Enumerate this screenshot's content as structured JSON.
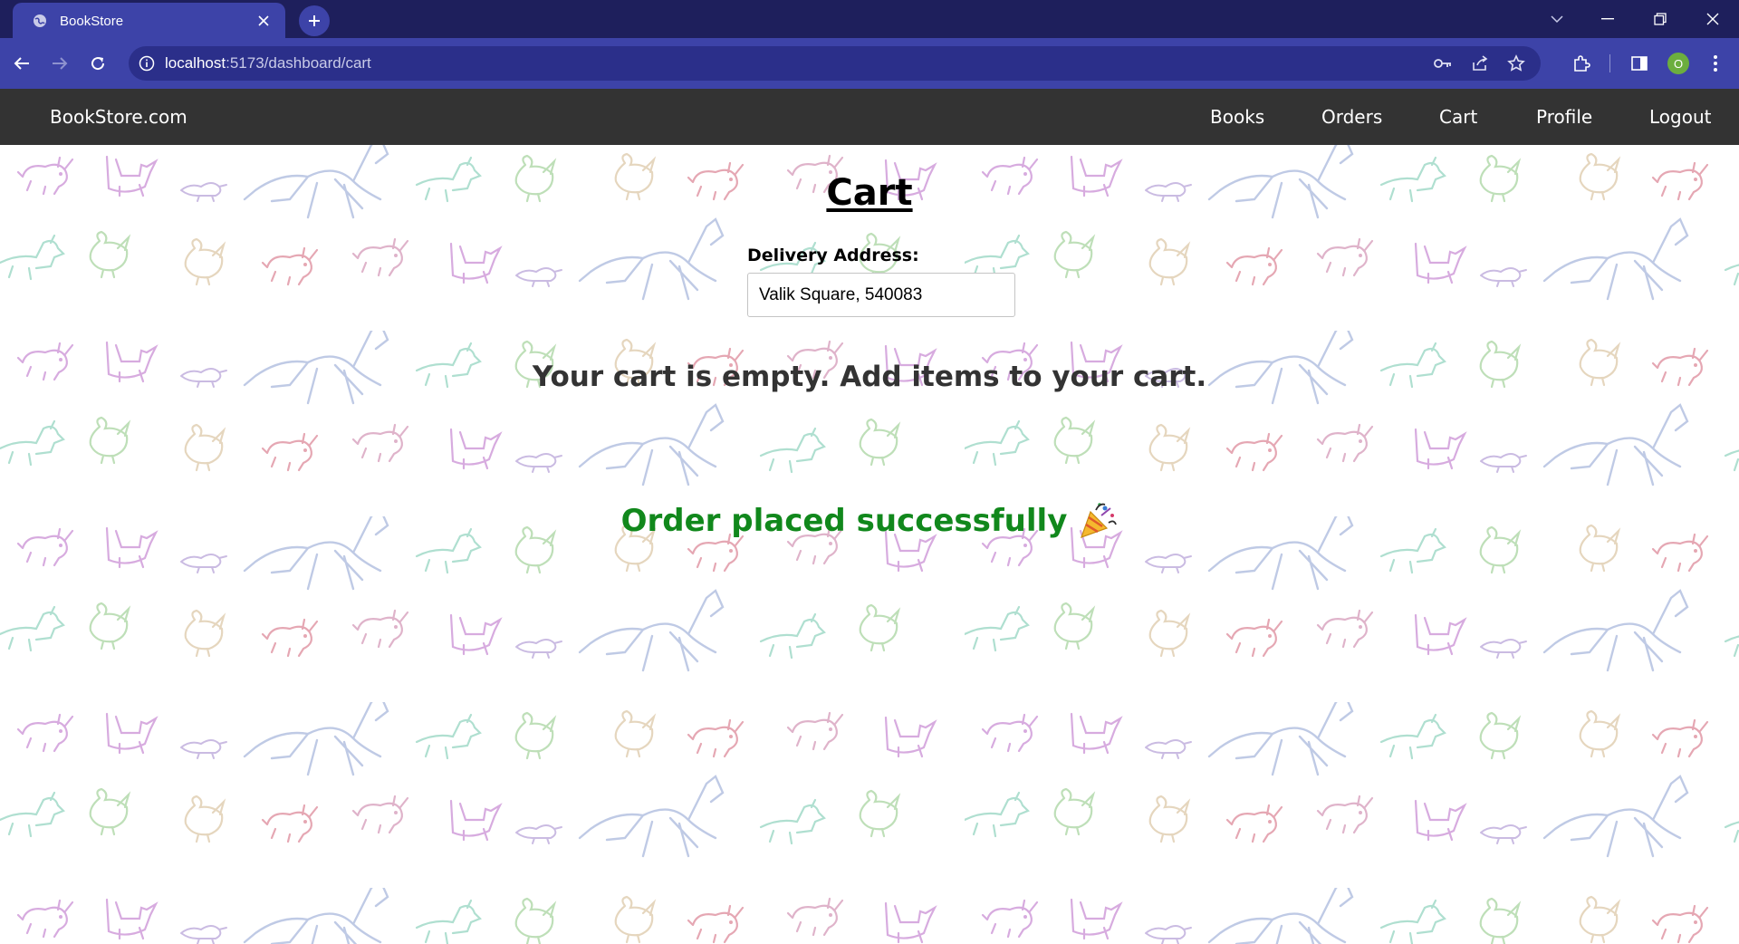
{
  "browser": {
    "tab": {
      "title": "BookStore",
      "favicon": "globe-icon"
    },
    "address_bar": {
      "host": "localhost",
      "rest": ":5173/dashboard/cart"
    },
    "profile_initial": "O",
    "colors": {
      "frame": "#1e1f5c",
      "toolbar": "#3d43a8",
      "omnibox": "#2b2f8a"
    }
  },
  "navbar": {
    "brand": "BookStore.com",
    "links": [
      {
        "label": "Books"
      },
      {
        "label": "Orders"
      },
      {
        "label": "Cart"
      },
      {
        "label": "Profile"
      },
      {
        "label": "Logout"
      }
    ],
    "background": "#333333"
  },
  "cart": {
    "title": "Cart",
    "address_label": "Delivery Address:",
    "address_value": "Valik Square, 540083",
    "empty_message": "Your cart is empty. Add items to your cart.",
    "success_message": "Order placed successfully",
    "success_icon": "party-popper-icon",
    "success_color": "#11881c"
  }
}
